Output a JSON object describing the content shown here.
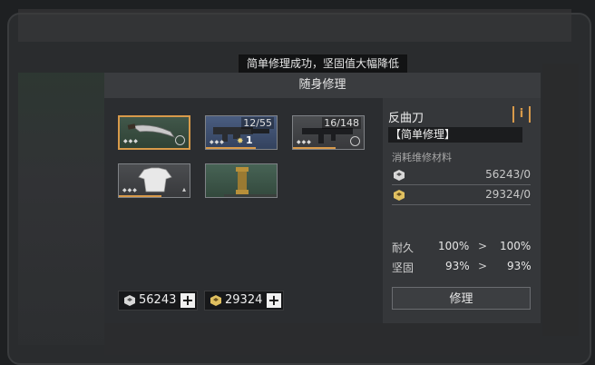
{
  "toast": "简单修理成功，坚固值大幅降低",
  "panel": {
    "title": "随身修理"
  },
  "inventory": [
    {
      "name": "machete",
      "count": "",
      "qty": "",
      "rarity_dots": "◆◆◆",
      "durability": 0.0
    },
    {
      "name": "grenade-launcher",
      "count": "12/55",
      "qty": "1",
      "rarity_dots": "◆◆◆",
      "durability": 0.7
    },
    {
      "name": "rifle",
      "count": "16/148",
      "qty": "",
      "rarity_dots": "◆◆◆",
      "durability": 0.6
    },
    {
      "name": "shirt",
      "count": "",
      "qty": "",
      "rarity_dots": "◆◆◆",
      "durability": 0.6
    },
    {
      "name": "pillar-relic",
      "count": "",
      "qty": "",
      "rarity_dots": "",
      "durability": 0.0
    }
  ],
  "currency": [
    {
      "icon": "silver-material-icon",
      "value": "56243"
    },
    {
      "icon": "gold-material-icon",
      "value": "29324"
    }
  ],
  "detail": {
    "item_name": "反曲刀",
    "info_label": "i",
    "repair_mode": "【简单修理】",
    "materials_title": "消耗维修材料",
    "materials": [
      {
        "icon": "silver-material-icon",
        "value": "56243/0"
      },
      {
        "icon": "gold-material-icon",
        "value": "29324/0"
      }
    ],
    "stats": [
      {
        "label": "耐久",
        "before": "100%",
        "after": "100%"
      },
      {
        "label": "坚固",
        "before": "93%",
        "after": "93%"
      }
    ],
    "arrow": ">",
    "repair_button": "修理"
  },
  "colors": {
    "accent": "#d89a4a",
    "panel": "#2e3033",
    "header": "#3a3c3f"
  }
}
